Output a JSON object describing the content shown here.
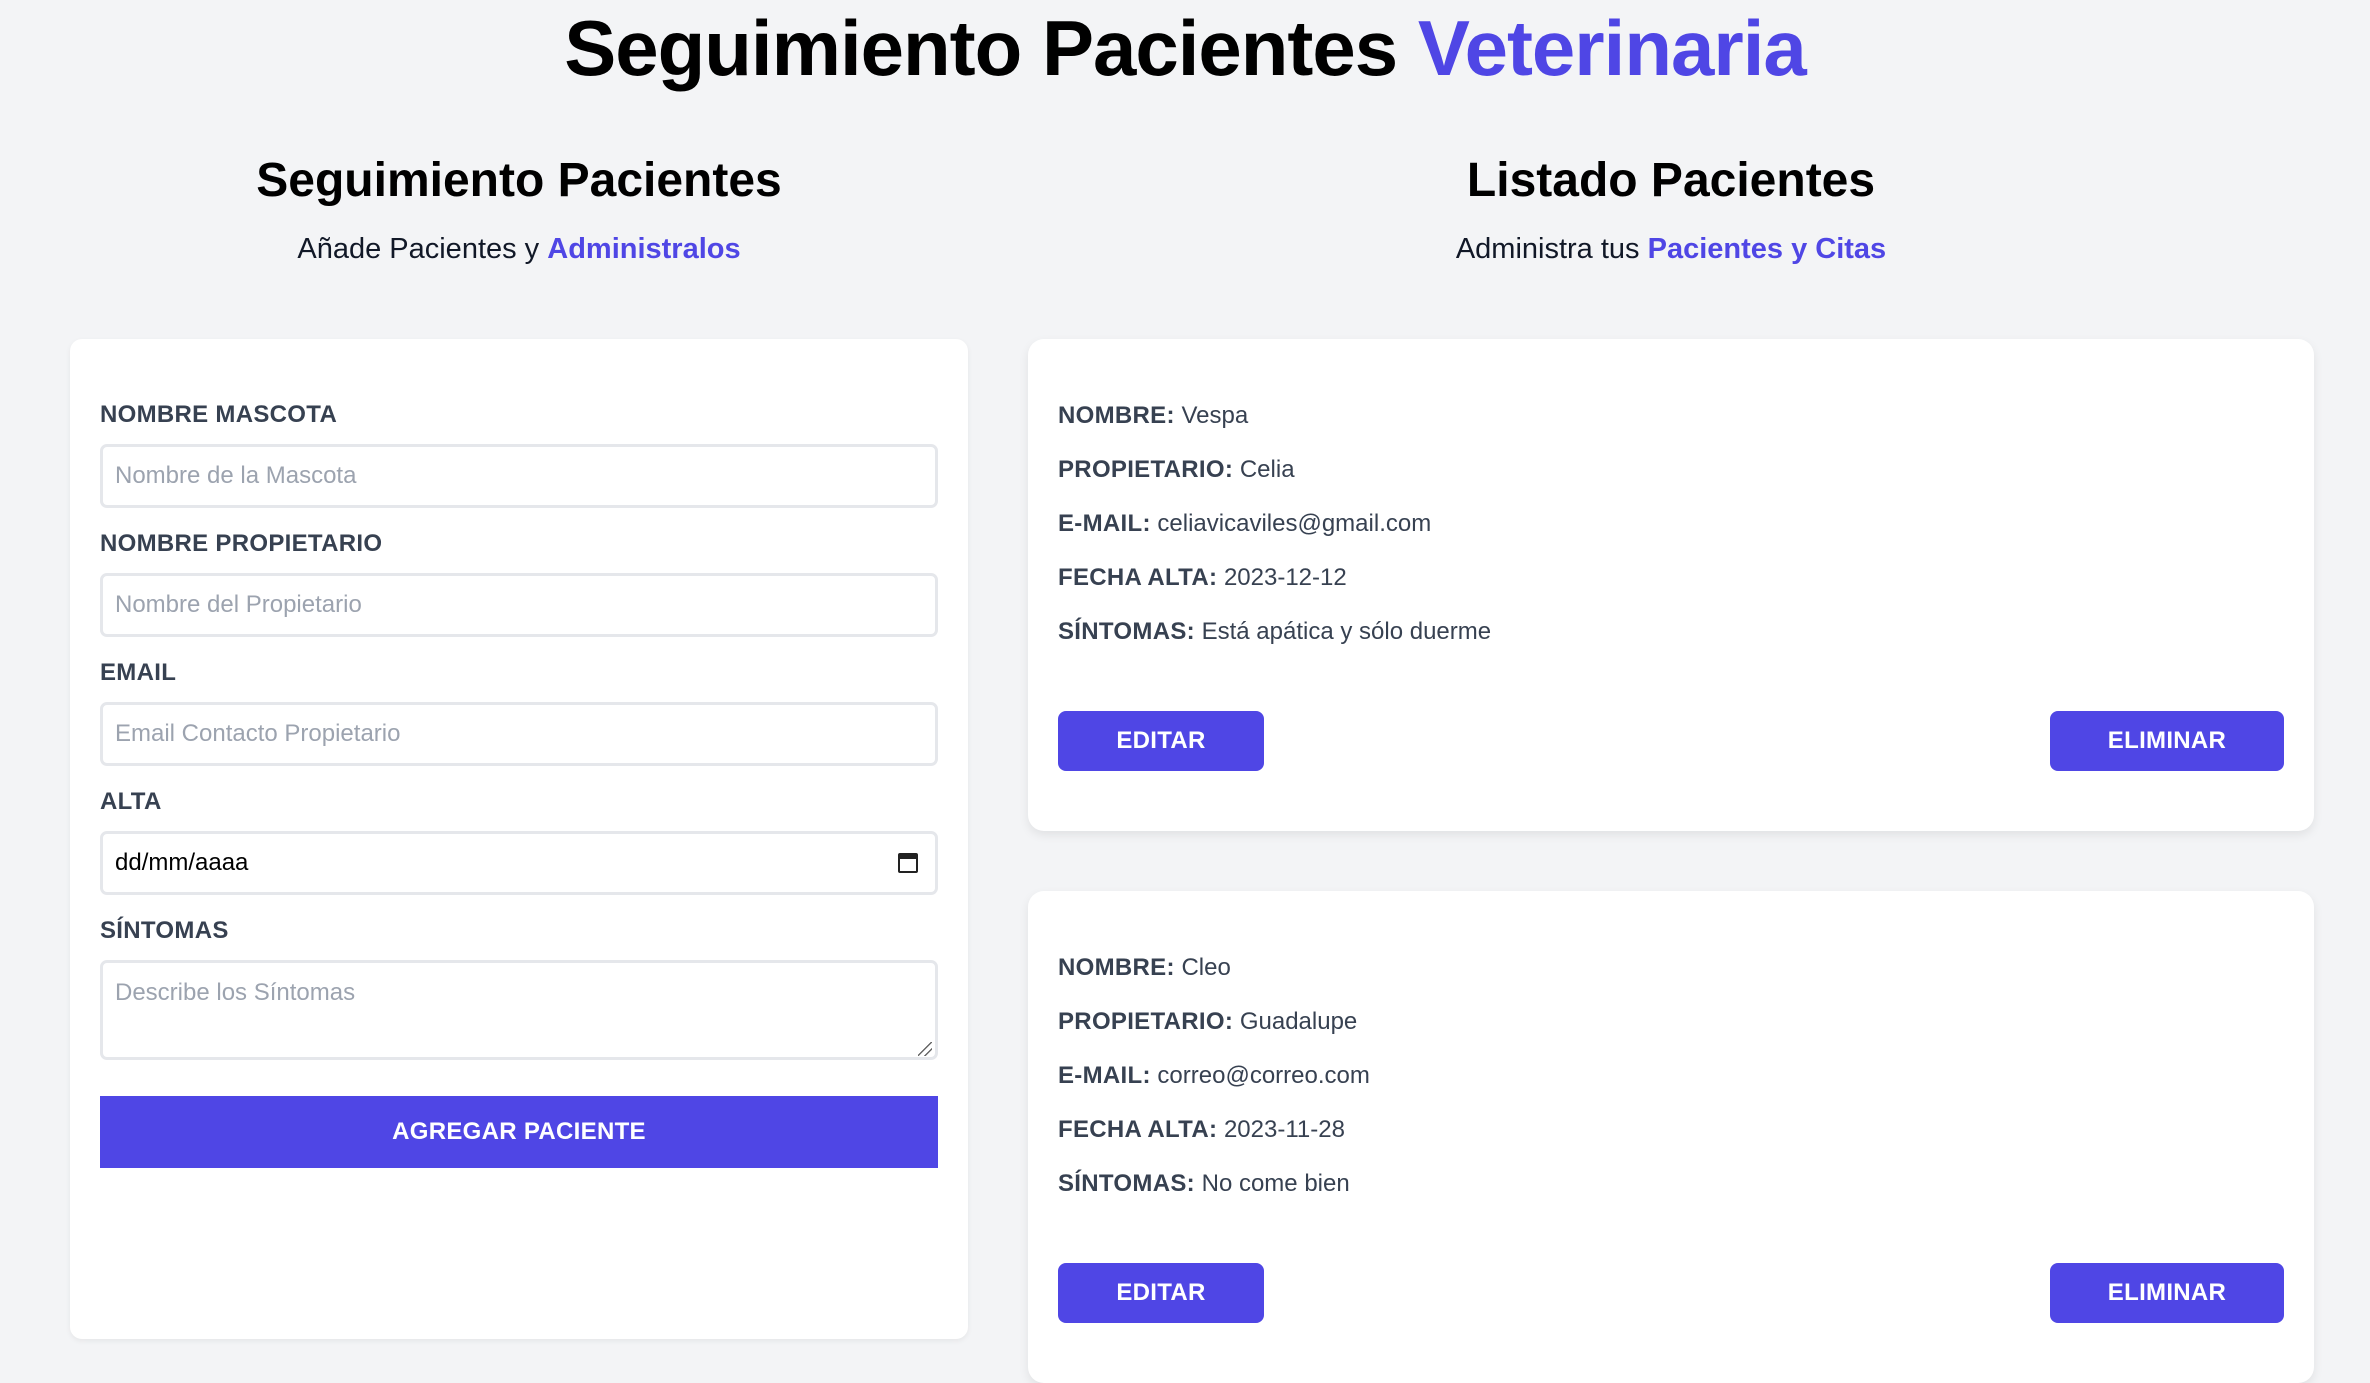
{
  "header": {
    "title_main": "Seguimiento Pacientes",
    "title_accent": "Veterinaria"
  },
  "form_section": {
    "heading": "Seguimiento Pacientes",
    "subtitle_plain": "Añade Pacientes y",
    "subtitle_accent": "Administralos"
  },
  "list_section": {
    "heading": "Listado Pacientes",
    "subtitle_plain": "Administra tus",
    "subtitle_accent": "Pacientes y Citas"
  },
  "form": {
    "fields": [
      {
        "label": "NOMBRE MASCOTA",
        "placeholder": "Nombre de la Mascota",
        "value": ""
      },
      {
        "label": "NOMBRE PROPIETARIO",
        "placeholder": "Nombre del Propietario",
        "value": ""
      },
      {
        "label": "EMAIL",
        "placeholder": "Email Contacto Propietario",
        "value": ""
      },
      {
        "label": "ALTA",
        "placeholder": "",
        "value": "dd/mm/aaaa"
      },
      {
        "label": "SÍNTOMAS",
        "placeholder": "Describe los Síntomas",
        "value": ""
      }
    ],
    "submit_label": "AGREGAR PACIENTE"
  },
  "patient_labels": {
    "name": "NOMBRE:",
    "owner": "PROPIETARIO:",
    "email": "E-MAIL:",
    "date": "FECHA ALTA:",
    "symptoms": "SÍNTOMAS:"
  },
  "patients": [
    {
      "name": "Vespa",
      "owner": "Celia",
      "email": "celiavicaviles@gmail.com",
      "date": "2023-12-12",
      "symptoms": "Está apática y sólo duerme",
      "edit_label": "EDITAR",
      "delete_label": "ELIMINAR"
    },
    {
      "name": "Cleo",
      "owner": "Guadalupe",
      "email": "correo@correo.com",
      "date": "2023-11-28",
      "symptoms": "No come bien",
      "edit_label": "EDITAR",
      "delete_label": "ELIMINAR"
    }
  ],
  "colors": {
    "accent": "#4f46e5",
    "background": "#f3f4f6",
    "card": "#ffffff"
  }
}
